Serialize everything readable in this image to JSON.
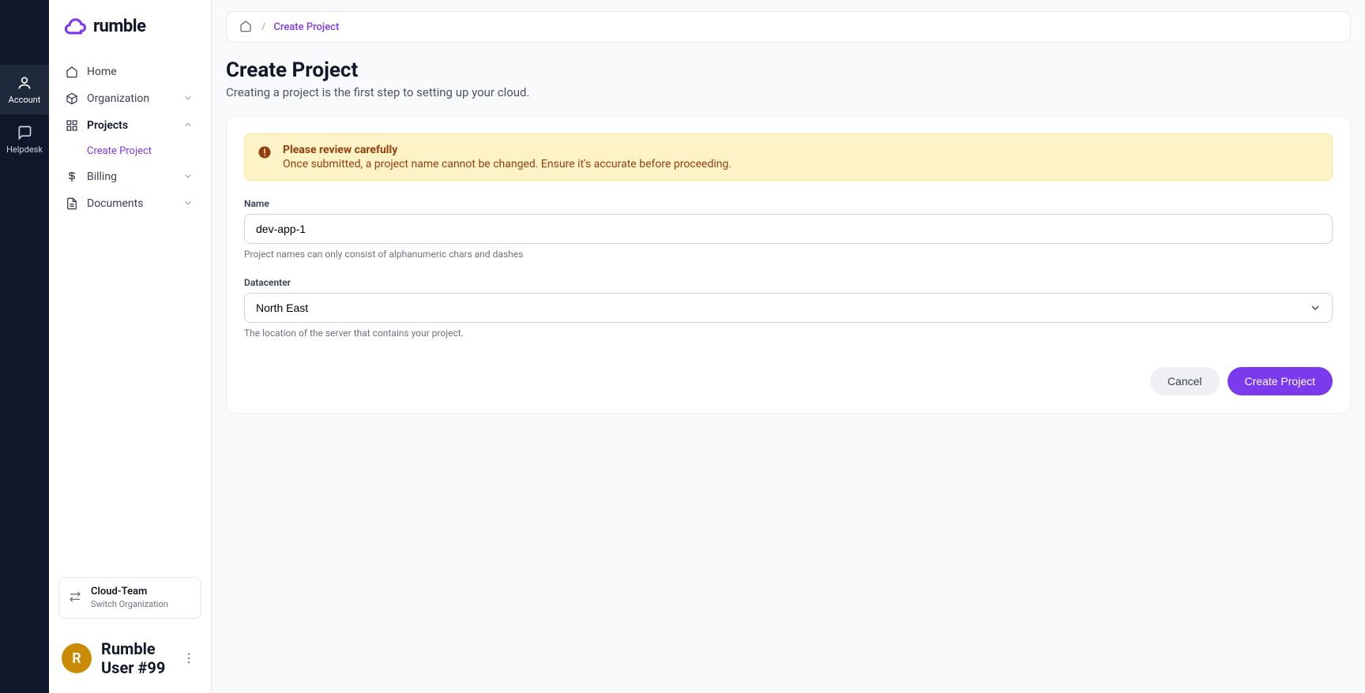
{
  "brand": {
    "name": "rumble"
  },
  "rail": {
    "account": "Account",
    "helpdesk": "Helpdesk"
  },
  "sidebar": {
    "items": [
      {
        "label": "Home"
      },
      {
        "label": "Organization"
      },
      {
        "label": "Projects"
      },
      {
        "label": "Billing"
      },
      {
        "label": "Documents"
      }
    ],
    "projects_sub": {
      "create": "Create Project"
    },
    "org_switcher": {
      "name": "Cloud-Team",
      "sub": "Switch Organization"
    },
    "user": {
      "initial": "R",
      "name": "Rumble User #99"
    }
  },
  "breadcrumb": {
    "current": "Create Project"
  },
  "page": {
    "title": "Create Project",
    "subtitle": "Creating a project is the first step to setting up your cloud."
  },
  "alert": {
    "title": "Please review carefully",
    "text": "Once submitted, a project name cannot be changed. Ensure it's accurate before proceeding."
  },
  "form": {
    "name_label": "Name",
    "name_value": "dev-app-1",
    "name_help": "Project names can only consist of alphanumeric chars and dashes",
    "dc_label": "Datacenter",
    "dc_value": "North East",
    "dc_help": "The location of the server that contains your project.",
    "cancel": "Cancel",
    "submit": "Create Project"
  }
}
